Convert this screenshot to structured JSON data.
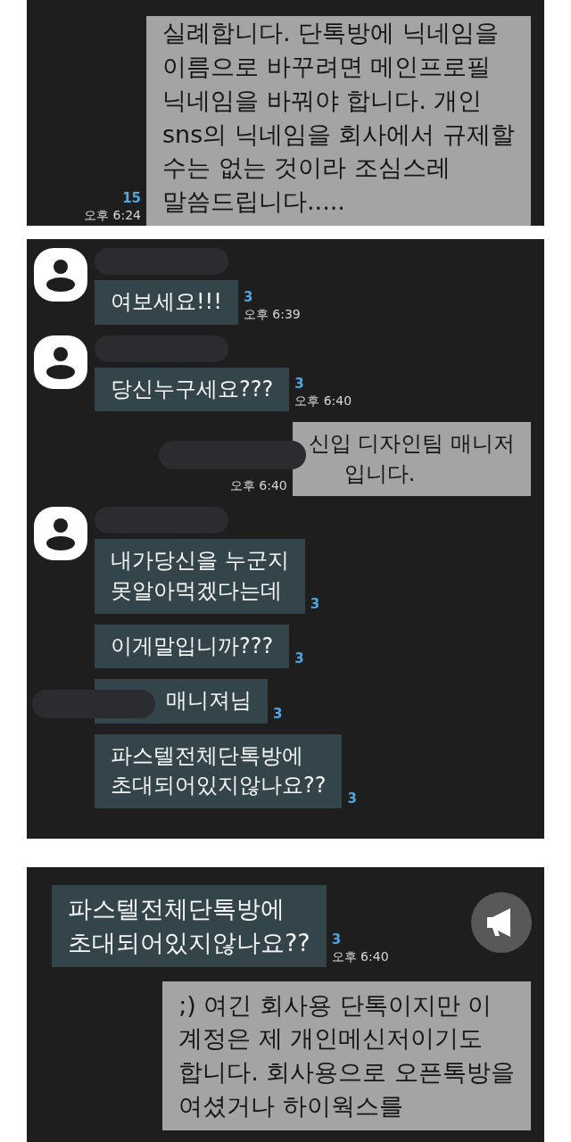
{
  "panels": [
    {
      "messages": [
        {
          "kind": "sent",
          "lines": [
            "실례합니다. 단톡방에 닉네임을",
            "이름으로 바꾸려면 메인프로필",
            "닉네임을 바꿔야 합니다. 개인",
            "sns의 닉네임을 회사에서 규제할",
            "수는 없는 것이라 조심스레",
            "말씀드립니다....."
          ],
          "count": "15",
          "time": "오후 6:24"
        }
      ]
    },
    {
      "messages": [
        {
          "kind": "received",
          "avatar": true,
          "lines": [
            "여보세요!!!"
          ],
          "count": "3",
          "time": "오후 6:39"
        },
        {
          "kind": "received",
          "avatar": true,
          "lines": [
            "당신누구세요???"
          ],
          "count": "3",
          "time": "오후 6:40"
        },
        {
          "kind": "sent",
          "lines": [
            "신입 디자인팀 매니저",
            "입니다."
          ],
          "time": "오후 6:40",
          "covered": true
        },
        {
          "kind": "received",
          "avatar": true,
          "lines": [
            "내가당신을 누군지",
            "못알아먹겠다는데"
          ],
          "count": "3"
        },
        {
          "kind": "received",
          "avatar": false,
          "lines": [
            "이게말입니까???"
          ],
          "count": "3"
        },
        {
          "kind": "received",
          "avatar": false,
          "lines": [
            "매니져님"
          ],
          "count": "3",
          "covered": true
        },
        {
          "kind": "received",
          "avatar": false,
          "lines": [
            "파스텔전체단톡방에",
            "초대되어있지않나요??"
          ],
          "count": "3"
        }
      ]
    },
    {
      "megaphone": true,
      "messages": [
        {
          "kind": "received",
          "avatar": false,
          "lines": [
            "파스텔전체단톡방에",
            "초대되어있지않나요??"
          ],
          "count": "3",
          "time": "오후 6:40"
        },
        {
          "kind": "sent",
          "lines": [
            ";) 여긴 회사용 단톡이지만 이",
            "계정은 제 개인메신저이기도",
            "합니다. 회사용으로 오픈톡방을",
            "여셨거나 하이웍스를"
          ]
        }
      ]
    }
  ]
}
